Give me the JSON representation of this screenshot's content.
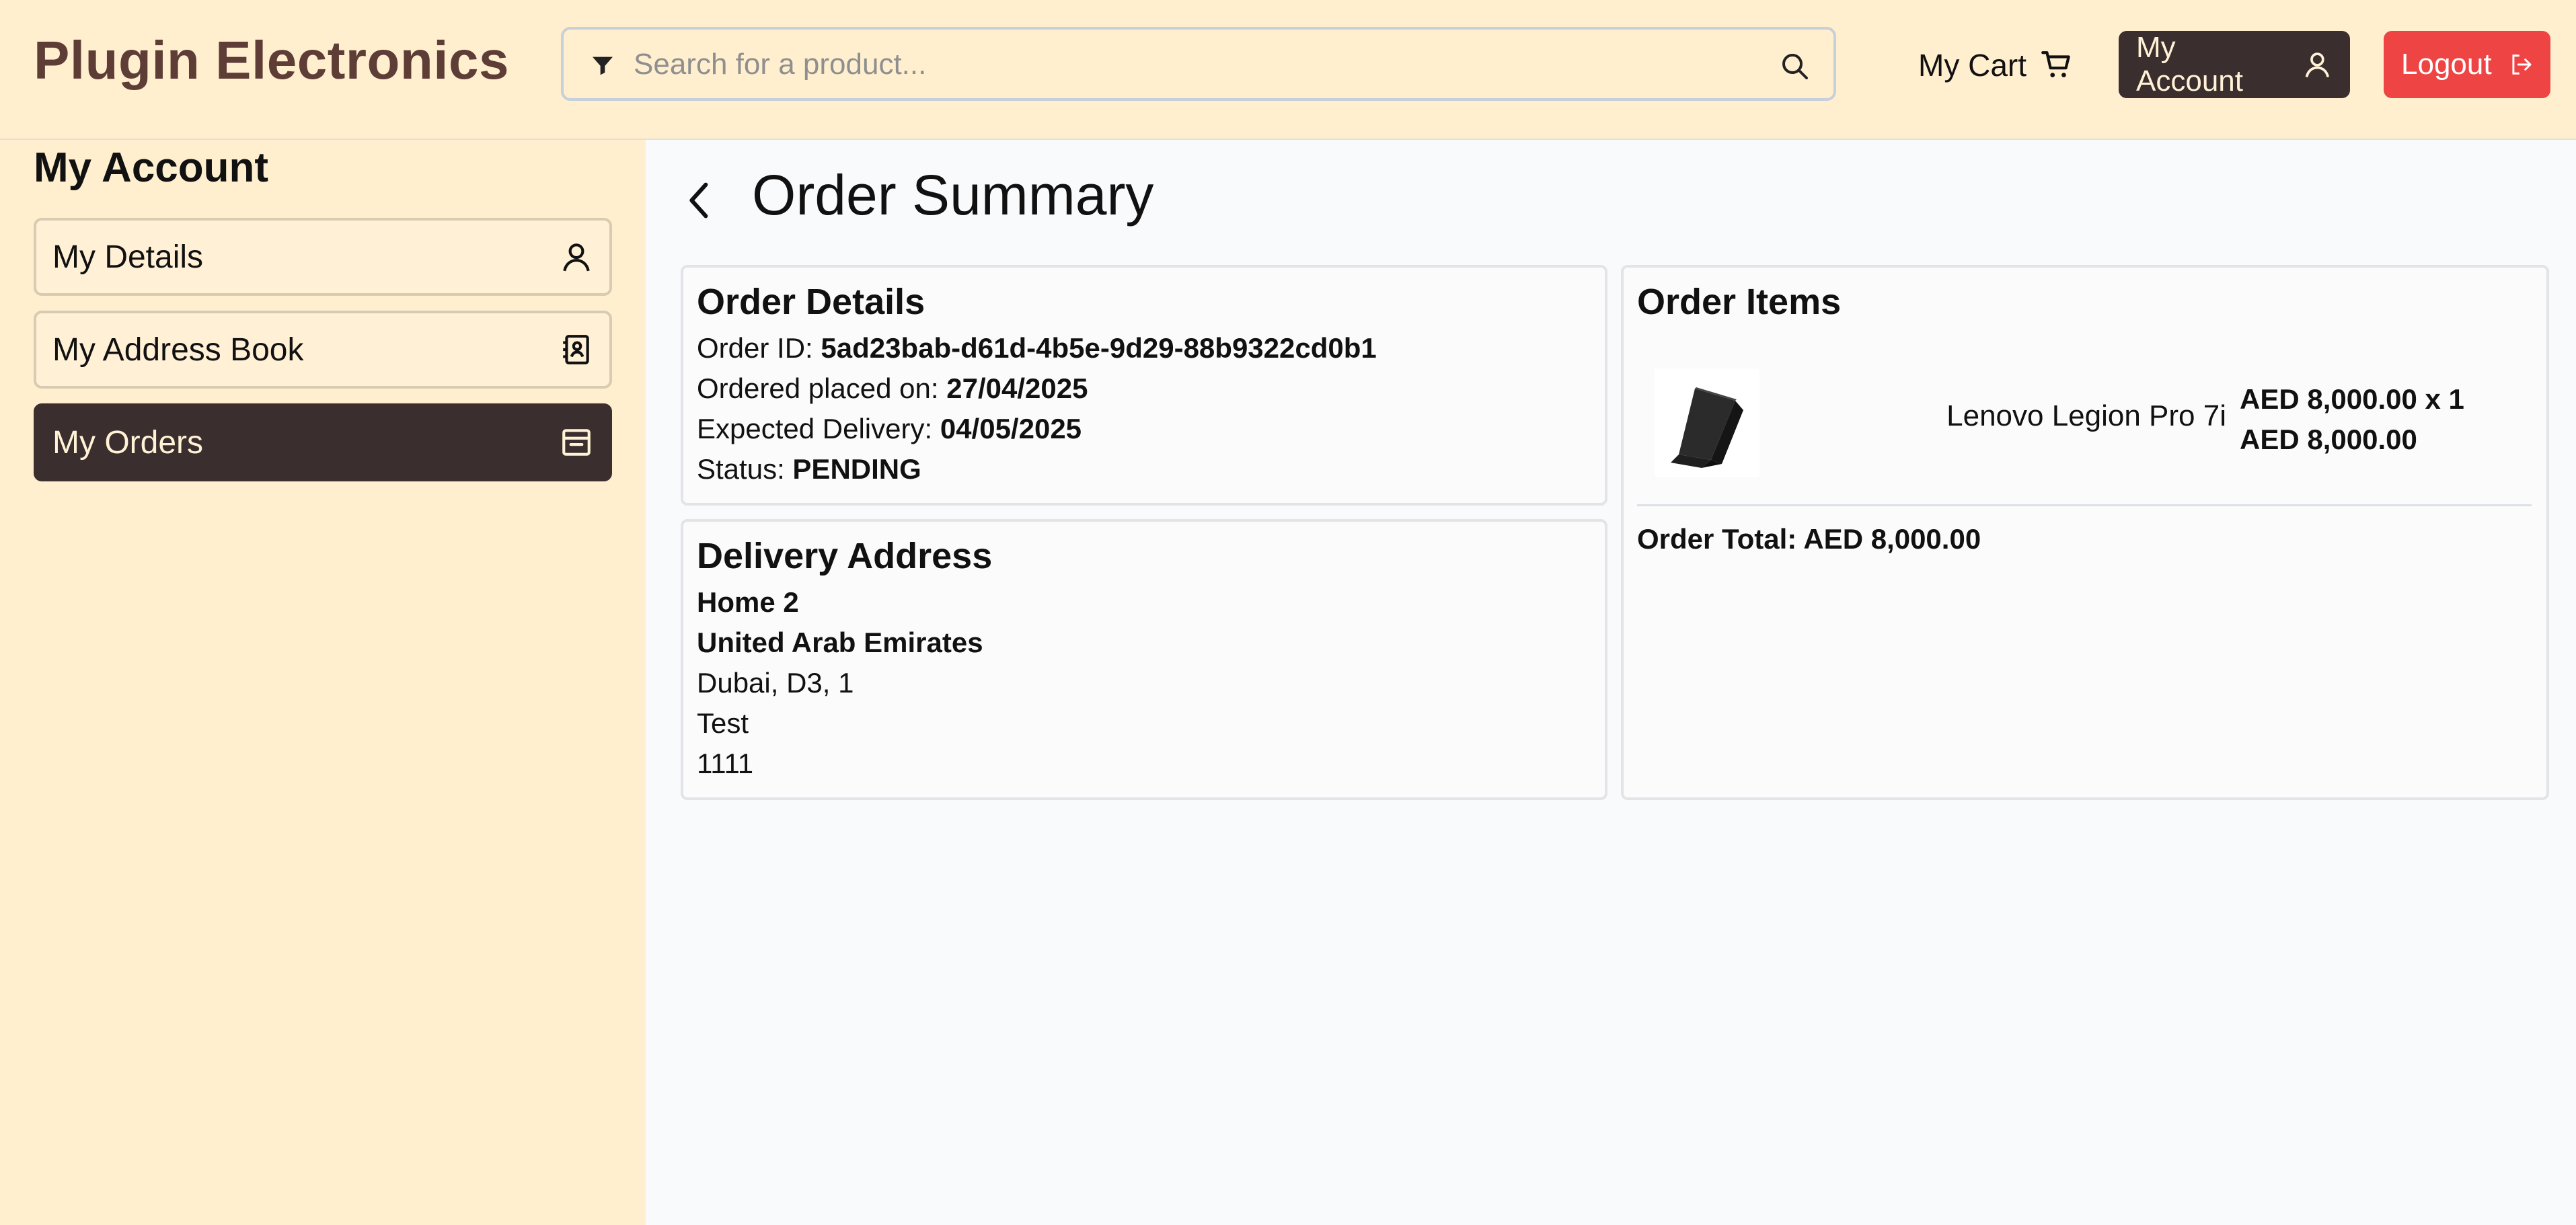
{
  "brand": "Plugin Electronics",
  "search": {
    "placeholder": "Search for a product..."
  },
  "header": {
    "cart_label": "My Cart",
    "account_label": "My Account",
    "logout_label": "Logout"
  },
  "sidebar": {
    "title": "My Account",
    "items": [
      {
        "label": "My Details",
        "icon": "user-icon"
      },
      {
        "label": "My Address Book",
        "icon": "address-book-icon"
      },
      {
        "label": "My Orders",
        "icon": "archive-box-icon",
        "active": true
      }
    ]
  },
  "page": {
    "title": "Order Summary"
  },
  "order_details": {
    "title": "Order Details",
    "order_id_label": "Order ID:",
    "order_id": "5ad23bab-d61d-4b5e-9d29-88b9322cd0b1",
    "placed_label": "Ordered placed on:",
    "placed_on": "27/04/2025",
    "delivery_label": "Expected Delivery:",
    "delivery_date": "04/05/2025",
    "status_label": "Status:",
    "status": "PENDING"
  },
  "delivery_address": {
    "title": "Delivery Address",
    "name": "Home 2",
    "country": "United Arab Emirates",
    "city_line": "Dubai, D3, 1",
    "line1": "Test",
    "line2": "1111"
  },
  "order_items": {
    "title": "Order Items",
    "items": [
      {
        "name": "Lenovo Legion Pro 7i",
        "unit_price": "AED 8,000.00 x 1",
        "subtotal": "AED 8,000.00"
      }
    ],
    "total": "Order Total: AED 8,000.00"
  },
  "colors": {
    "header_bg": "#ffefcf",
    "brand": "#5d3d36",
    "dark": "#3a2e2e",
    "logout": "#ef4444"
  }
}
